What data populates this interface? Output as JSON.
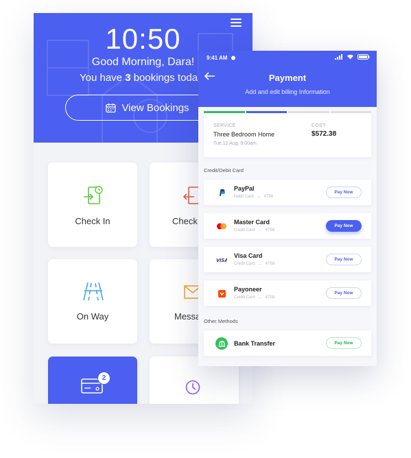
{
  "dashboard": {
    "time": "10:50",
    "greeting": "Good Morning, Dara!",
    "bookings_prefix": "You have ",
    "bookings_count": "3",
    "bookings_suffix": " bookings toda",
    "view_bookings_label": "View Bookings",
    "tiles": [
      {
        "label": "Check In",
        "icon": "check-in-icon"
      },
      {
        "label": "Check",
        "icon": "check-out-icon"
      },
      {
        "label": "On Way",
        "icon": "road-icon"
      },
      {
        "label": "Messa",
        "icon": "envelope-icon"
      },
      {
        "label": "",
        "icon": "card-icon",
        "badge": "2"
      },
      {
        "label": "",
        "icon": "clock-icon"
      }
    ]
  },
  "payment": {
    "status_time": "9:41 AM",
    "title": "Payment",
    "subtitle": "Add and edit billing Information",
    "service_label": "SERVICE",
    "service_name": "Three Bedroom Home",
    "service_date": "Tue,12 Aug, 9:00am",
    "cost_label": "COST",
    "cost_value": "$572.38",
    "card_section": "Credit/Debit Card",
    "other_section": "Other Methods",
    "methods": [
      {
        "name": "PayPal",
        "detail": "Debit Card   ...   4758",
        "button": "Pay Now",
        "style": "outline"
      },
      {
        "name": "Master Card",
        "detail": "Credit Card   ...   4758",
        "button": "Pay Now",
        "style": "filled"
      },
      {
        "name": "Visa Card",
        "detail": "Credit Card   ...   4758",
        "button": "Pay Now",
        "style": "outline"
      },
      {
        "name": "Payoneer",
        "detail": "Credit Card   ...   4758",
        "button": "Pay Now",
        "style": "outline"
      }
    ],
    "other": {
      "name": "Bank Transfer",
      "button": "Pay Now",
      "style": "green"
    },
    "progress_colors": [
      "#2fc25b",
      "#4b5ff0",
      "#dfe1ea",
      "#dfe1ea"
    ]
  },
  "colors": {
    "accent": "#4b5ff0",
    "green": "#2fc25b"
  }
}
